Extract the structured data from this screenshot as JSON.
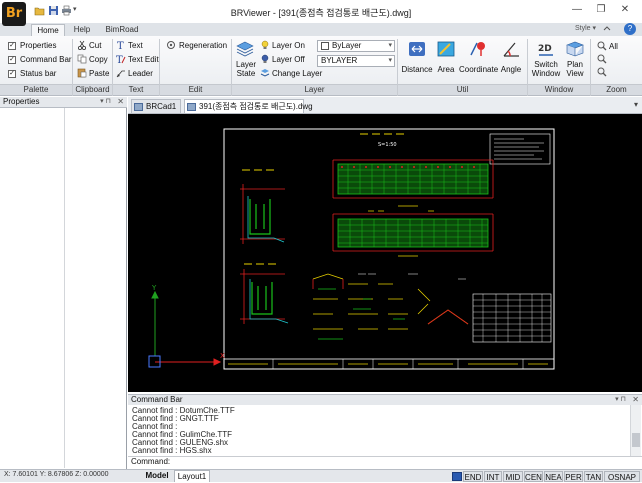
{
  "app": {
    "title": "BRViewer - [391(종점측 접검통로 배근도).dwg]",
    "logo": "Br",
    "style_label": "Style",
    "window_controls": [
      "minimize-icon",
      "restore-icon",
      "close-icon"
    ],
    "quick_access": [
      "open-folder-icon",
      "save-icon",
      "print-icon",
      "dropdown-icon"
    ]
  },
  "ribbon_tabs": [
    "Home",
    "Help",
    "BimRoad"
  ],
  "ribbon": {
    "palette": {
      "group": "Palette",
      "items": [
        "Properties",
        "Command Bar",
        "Status bar"
      ]
    },
    "clipboard": {
      "group": "Clipboard",
      "items": [
        "Cut",
        "Copy",
        "Paste"
      ]
    },
    "text": {
      "group": "Text",
      "items": [
        "Text",
        "Text Edit",
        "Leader"
      ]
    },
    "edit": {
      "group": "Edit",
      "regen": "Regeneration"
    },
    "layer": {
      "group": "Layer",
      "state": "Layer State",
      "on": "Layer On",
      "off": "Layer Off",
      "change": "Change Layer",
      "color_combo": "ByLayer",
      "layer_combo": "BYLAYER"
    },
    "util": {
      "group": "Util",
      "items": [
        "Distance",
        "Area",
        "Coordinate",
        "Angle"
      ]
    },
    "window": {
      "group": "Window",
      "items": [
        "Switch Window",
        "Plan View"
      ]
    },
    "zoom": {
      "group": "Zoom",
      "all": "All"
    }
  },
  "properties_panel": {
    "title": "Properties"
  },
  "doc_tabs": [
    "BRCad1",
    "391(종점측 점검통로 배근도).dwg"
  ],
  "drawing": {
    "axis_y": "Y",
    "axis_x": "X",
    "scale_label": "S=1:50",
    "colors": {
      "background": "#000000",
      "frame": "#ffffff",
      "green": "#19c11a",
      "red": "#e02020",
      "yellow": "#e6d000",
      "cyan": "#20c8d0",
      "magenta": "#d020d0"
    }
  },
  "command_bar": {
    "title": "Command Bar",
    "lines": [
      "Cannot find : DotumChe.TTF",
      "Cannot find : GNGT.TTF",
      "Cannot find :",
      "Cannot find : GulimChe.TTF",
      "Cannot find : GULENG.shx",
      "Cannot find : HGS.shx"
    ],
    "prompt": "Command:"
  },
  "status": {
    "coords": "X: 7.60101  Y: 8.67806  Z: 0.00000",
    "layouts": [
      "Model",
      "Layout1"
    ],
    "snaps": [
      "END",
      "INT",
      "MID",
      "CEN",
      "NEA",
      "PER",
      "TAN",
      "OSNAP"
    ]
  }
}
